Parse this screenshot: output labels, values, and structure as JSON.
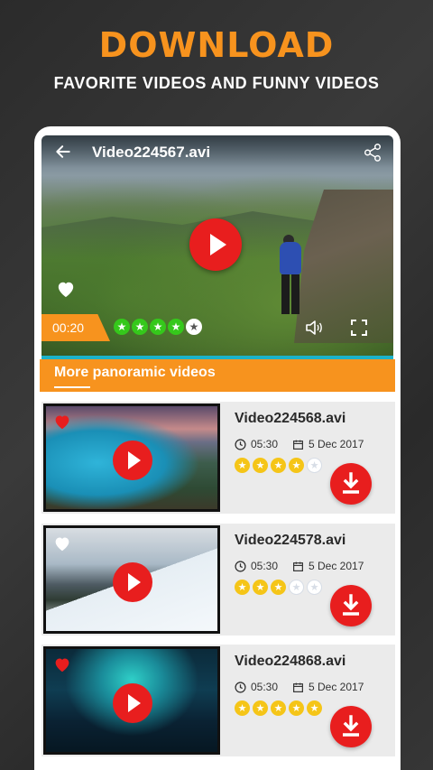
{
  "hero": {
    "title": "DOWNLOAD",
    "subtitle": "FAVORITE VIDEOS AND FUNNY VIDEOS"
  },
  "player": {
    "title": "Video224567.avi",
    "current_time": "00:20",
    "rating": 4,
    "max_rating": 5,
    "accent_color": "#35c81b"
  },
  "section": {
    "title": "More panoramic videos"
  },
  "videos": [
    {
      "title": "Video224568.avi",
      "duration": "05:30",
      "date": "5 Dec 2017",
      "rating": 4,
      "favorite": true,
      "thumbnail": "lake"
    },
    {
      "title": "Video224578.avi",
      "duration": "05:30",
      "date": "5 Dec 2017",
      "rating": 3,
      "favorite": false,
      "thumbnail": "snow"
    },
    {
      "title": "Video224868.avi",
      "duration": "05:30",
      "date": "5 Dec 2017",
      "rating": 5,
      "favorite": true,
      "thumbnail": "cave"
    }
  ],
  "colors": {
    "brand_orange": "#f7931e",
    "play_red": "#e81e1e",
    "star_yellow": "#f5c518",
    "progress_cyan": "#1bb3c9"
  },
  "icons": {
    "back": "arrow-left-icon",
    "share": "share-icon",
    "volume": "volume-icon",
    "fullscreen": "fullscreen-icon",
    "download": "download-icon",
    "clock": "clock-icon",
    "calendar": "calendar-icon",
    "heart": "heart-icon"
  }
}
